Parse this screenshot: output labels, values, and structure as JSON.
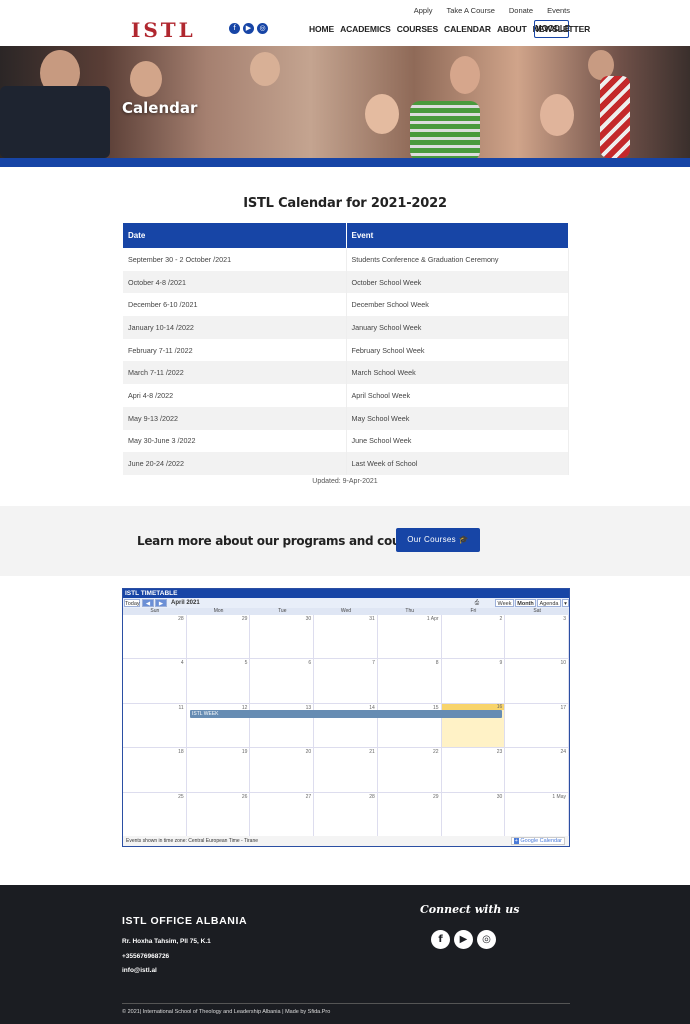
{
  "header": {
    "logo": "ISTL",
    "social_icons": [
      "facebook-icon",
      "youtube-icon",
      "instagram-icon"
    ],
    "utility_links": [
      "Apply",
      "Take A Course",
      "Donate",
      "Events"
    ],
    "nav": [
      "HOME",
      "ACADEMICS",
      "COURSES",
      "CALENDAR",
      "ABOUT",
      "NEWSLETTER"
    ],
    "moodle": "MOODLE"
  },
  "hero": {
    "title": "Calendar"
  },
  "calendar_section": {
    "title": "ISTL Calendar for 2021-2022",
    "columns": [
      "Date",
      "Event"
    ],
    "rows": [
      [
        "September 30 - 2 October /2021",
        "Students Conference & Graduation Ceremony"
      ],
      [
        "October 4-8 /2021",
        "October School Week"
      ],
      [
        "December 6-10 /2021",
        "December School Week"
      ],
      [
        "January 10-14 /2022",
        "January School Week"
      ],
      [
        "February 7-11 /2022",
        "February School Week"
      ],
      [
        "March 7-11 /2022",
        "March School Week"
      ],
      [
        "Apri 4-8 /2022",
        "April School Week"
      ],
      [
        "May 9-13 /2022",
        "May School Week"
      ],
      [
        "May 30-June 3 /2022",
        "June School Week"
      ],
      [
        "June 20-24 /2022",
        "Last Week of School"
      ]
    ],
    "updated": "Updated: 9-Apr-2021"
  },
  "cta": {
    "text": "Learn more about our programs and courses",
    "button": "Our Courses"
  },
  "embed_calendar": {
    "title": "ISTL TIMETABLE",
    "today": "Today",
    "month": "April 2021",
    "views": [
      "Week",
      "Month",
      "Agenda"
    ],
    "days": [
      "Sun",
      "Mon",
      "Tue",
      "Wed",
      "Thu",
      "Fri",
      "Sat"
    ],
    "dates": [
      "28",
      "29",
      "30",
      "31",
      "1 Apr",
      "2",
      "3",
      "4",
      "5",
      "6",
      "7",
      "8",
      "9",
      "10",
      "11",
      "12",
      "13",
      "14",
      "15",
      "16",
      "17",
      "18",
      "19",
      "20",
      "21",
      "22",
      "23",
      "24",
      "25",
      "26",
      "27",
      "28",
      "29",
      "30",
      "1 May"
    ],
    "event": "ISTL WEEK",
    "timezone": "Events shown in time zone: Central European Time - Tirane",
    "google": "Google Calendar"
  },
  "footer": {
    "office_title": "ISTL OFFICE ALBANIA",
    "address": "Rr. Hoxha Tahsim, Pll 75, K.1",
    "phone": "+355676968726",
    "email": "info@istl.al",
    "connect": "Connect with us",
    "copyright": "© 2021| International School of Theology and Leadership Albania | Made by Sfida.Pro"
  }
}
